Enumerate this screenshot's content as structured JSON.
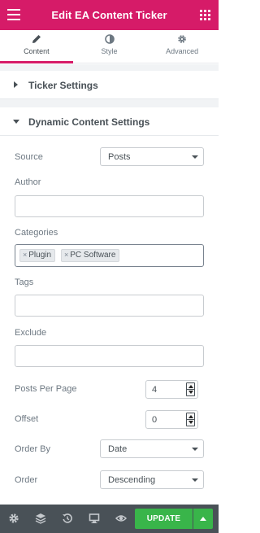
{
  "header": {
    "title": "Edit EA Content Ticker",
    "menu_icon": "hamburger-icon",
    "grid_icon": "apps-grid-icon"
  },
  "tabs": [
    {
      "label": "Content",
      "icon": "pencil-icon",
      "active": true
    },
    {
      "label": "Style",
      "icon": "contrast-icon",
      "active": false
    },
    {
      "label": "Advanced",
      "icon": "gear-icon",
      "active": false
    }
  ],
  "sections": {
    "ticker_settings": "Ticker Settings",
    "dynamic_content_settings": "Dynamic Content Settings"
  },
  "controls": {
    "source": {
      "label": "Source",
      "value": "Posts"
    },
    "author": {
      "label": "Author",
      "value": ""
    },
    "categories": {
      "label": "Categories",
      "chips": [
        "Plugin",
        "PC Software"
      ]
    },
    "tags": {
      "label": "Tags",
      "value": ""
    },
    "exclude": {
      "label": "Exclude",
      "value": ""
    },
    "posts_per_page": {
      "label": "Posts Per Page",
      "value": "4"
    },
    "offset": {
      "label": "Offset",
      "value": "0"
    },
    "order_by": {
      "label": "Order By",
      "value": "Date"
    },
    "order": {
      "label": "Order",
      "value": "Descending"
    }
  },
  "footer": {
    "update_label": "UPDATE",
    "icons": [
      "settings-icon",
      "layers-icon",
      "history-icon",
      "responsive-icon",
      "preview-eye-icon"
    ]
  },
  "colors": {
    "brand": "#d61b68",
    "footer_bg": "#495157",
    "update_green": "#39b54a"
  }
}
